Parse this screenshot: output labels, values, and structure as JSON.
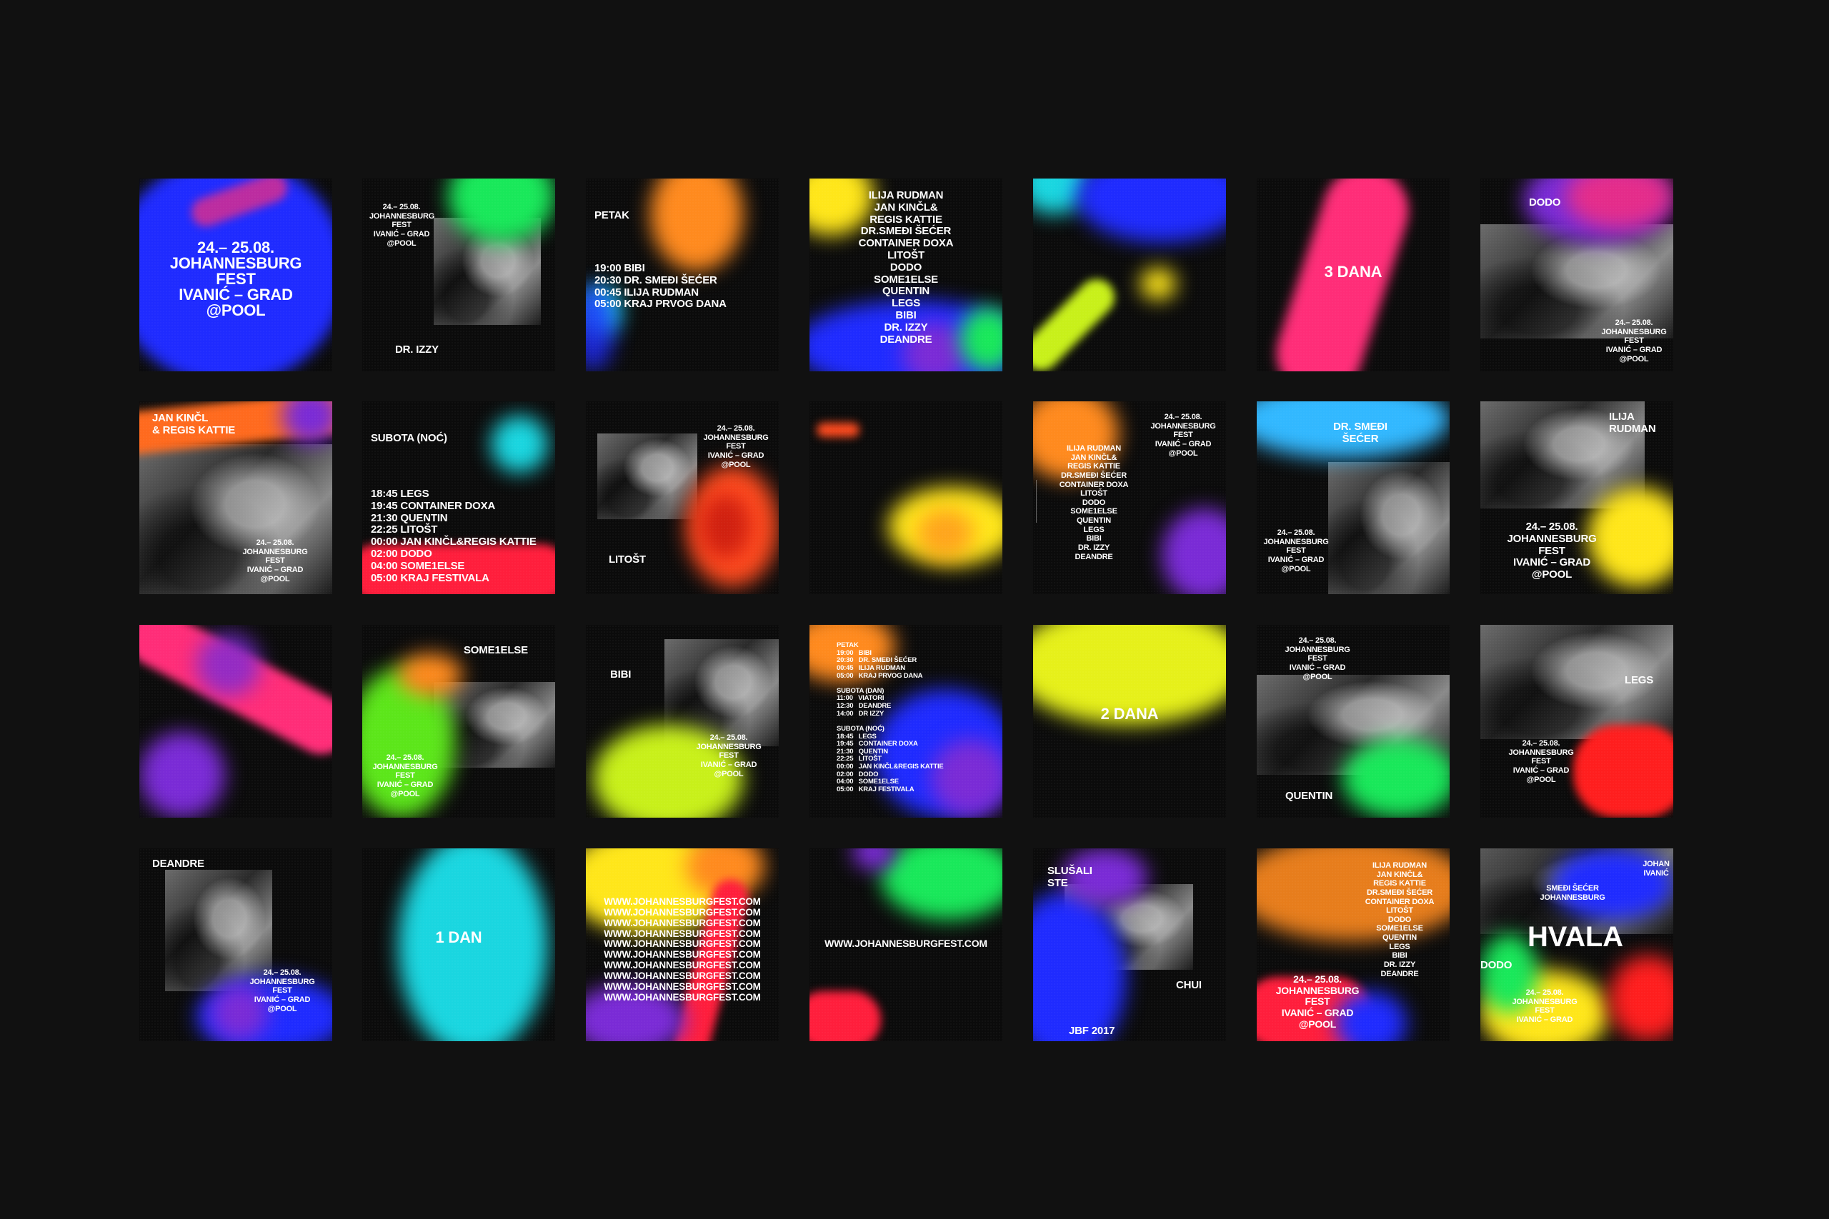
{
  "tiles": {
    "t1": {
      "lines": "24.– 25.08.\nJOHANNESBURG\nFEST\nIVANIĆ – GRAD\n@POOL"
    },
    "t2": {
      "info": "24.– 25.08.\nJOHANNESBURG\nFEST\nIVANIĆ – GRAD\n@POOL",
      "name": "DR. IZZY"
    },
    "t3": {
      "head": "PETAK",
      "list": "19:00 BIBI\n20:30 DR. SMEĐI ŠEĆER\n00:45 ILIJA RUDMAN\n05:00 KRAJ PRVOG DANA"
    },
    "t4": {
      "list": "ILIJA RUDMAN\nJAN KINČL&\nREGIS KATTIE\nDR.SMEĐI ŠEĆER\nCONTAINER DOXA\nLITOŠT\nDODO\nSOME1ELSE\nQUENTIN\nLEGS\nBIBI\nDR. IZZY\nDEANDRE"
    },
    "t6": {
      "label": "3 DANA"
    },
    "t7": {
      "name": "DODO",
      "info": "24.– 25.08.\nJOHANNESBURG\nFEST\nIVANIĆ – GRAD\n@POOL"
    },
    "t8": {
      "name": "JAN KINČL\n& REGIS KATTIE",
      "info": "24.– 25.08.\nJOHANNESBURG\nFEST\nIVANIĆ – GRAD\n@POOL"
    },
    "t9": {
      "head": "SUBOTA (NOĆ)",
      "list": "18:45 LEGS\n19:45 CONTAINER DOXA\n21:30 QUENTIN\n22:25 LITOŠT\n00:00 JAN KINČL&REGIS KATTIE\n02:00 DODO\n04:00 SOME1ELSE\n05:00 KRAJ FESTIVALA"
    },
    "t10": {
      "info": "24.– 25.08.\nJOHANNESBURG\nFEST\nIVANIĆ – GRAD\n@POOL",
      "name": "LITOŠT"
    },
    "t12": {
      "info": "24.– 25.08.\nJOHANNESBURG\nFEST\nIVANIĆ – GRAD\n@POOL",
      "list": "ILIJA RUDMAN\nJAN KINČL&\nREGIS KATTIE\nDR.SMEĐI ŠEĆER\nCONTAINER DOXA\nLITOŠT\nDODO\nSOME1ELSE\nQUENTIN\nLEGS\nBIBI\nDR. IZZY\nDEANDRE"
    },
    "t13": {
      "name": "DR. SMEĐI\nŠEĆER",
      "info": "24.– 25.08.\nJOHANNESBURG\nFEST\nIVANIĆ – GRAD\n@POOL"
    },
    "t14": {
      "name": "ILIJA\nRUDMAN",
      "info": "24.– 25.08.\nJOHANNESBURG\nFEST\nIVANIĆ – GRAD\n@POOL"
    },
    "t16": {
      "name": "SOME1ELSE",
      "info": "24.– 25.08.\nJOHANNESBURG\nFEST\nIVANIĆ – GRAD\n@POOL"
    },
    "t17": {
      "name": "BIBI",
      "info": "24.– 25.08.\nJOHANNESBURG\nFEST\nIVANIĆ – GRAD\n@POOL"
    },
    "t18": {
      "schedule": "PETAK\n19:00   BIBI\n20:30   DR. SMEĐI ŠEĆER\n00:45   ILIJA RUDMAN\n05:00   KRAJ PRVOG DANA\n\nSUBOTA (DAN)\n11:00   VIATORI\n12:30   DEANDRE\n14:00   DR IZZY\n\nSUBOTA (NOĆ)\n18:45   LEGS\n19:45   CONTAINER DOXA\n21:30   QUENTIN\n22:25   LITOŠT\n00:00   JAN KINČL&REGIS KATTIE\n02:00   DODO\n04:00   SOME1ELSE\n05:00   KRAJ FESTIVALA"
    },
    "t19": {
      "label": "2 DANA"
    },
    "t20": {
      "info": "24.– 25.08.\nJOHANNESBURG\nFEST\nIVANIĆ – GRAD\n@POOL",
      "name": "QUENTIN"
    },
    "t21": {
      "name": "LEGS",
      "info": "24.– 25.08.\nJOHANNESBURG\nFEST\nIVANIĆ – GRAD\n@POOL"
    },
    "t22": {
      "name": "DEANDRE",
      "info": "24.– 25.08.\nJOHANNESBURG\nFEST\nIVANIĆ – GRAD\n@POOL"
    },
    "t23": {
      "label": "1 DAN"
    },
    "t24": {
      "list": "WWW.JOHANNESBURGFEST.COM\nWWW.JOHANNESBURGFEST.COM\nWWW.JOHANNESBURGFEST.COM\nWWW.JOHANNESBURGFEST.COM\nWWW.JOHANNESBURGFEST.COM\nWWW.JOHANNESBURGFEST.COM\nWWW.JOHANNESBURGFEST.COM\nWWW.JOHANNESBURGFEST.COM\nWWW.JOHANNESBURGFEST.COM\nWWW.JOHANNESBURGFEST.COM"
    },
    "t25": {
      "url": "WWW.JOHANNESBURGFEST.COM"
    },
    "t26": {
      "head": "SLUŠALI\nSTE",
      "name": "CHUI",
      "foot": "JBF 2017"
    },
    "t27": {
      "list": "ILIJA RUDMAN\nJAN KINČL&\nREGIS KATTIE\nDR.SMEĐI ŠEĆER\nCONTAINER DOXA\nLITOŠT\nDODO\nSOME1ELSE\nQUENTIN\nLEGS\nBIBI\nDR. IZZY\nDEANDRE",
      "info": "24.– 25.08.\nJOHANNESBURG\nFEST\nIVANIĆ – GRAD\n@POOL"
    },
    "t28": {
      "label": "HVALA",
      "info": "24.– 25.08.\nJOHANNESBURG\nFEST\nIVANIĆ – GRAD",
      "frag1": "JOHAN\nIVANIĆ",
      "frag2": "DODO",
      "frag3": "SMEĐI ŠEĆER\nJOHANNESBURG"
    }
  },
  "colors": {
    "background": "#111111",
    "blue": "#1f2bff",
    "green": "#19e85a",
    "orange": "#ff8a1e",
    "yellow": "#ffe61a",
    "pink": "#ff2d78",
    "purple": "#7a2bd6",
    "cyan": "#1ad6e0",
    "red": "#ff2a1a",
    "lime": "#c8f01a"
  }
}
